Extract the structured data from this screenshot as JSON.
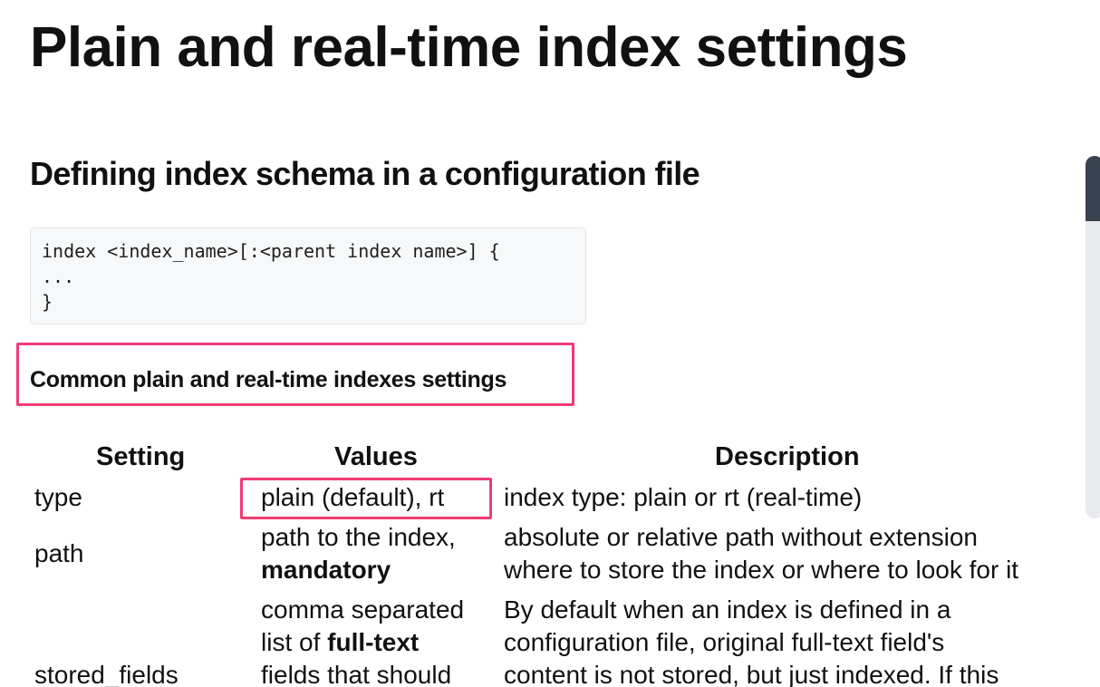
{
  "title": "Plain and real-time index settings",
  "section": {
    "heading": "Defining index schema in a configuration file",
    "code_lines": [
      "index <index_name>[:<parent index name>] {",
      "...",
      "}"
    ],
    "subheading": "Common plain and real-time indexes settings"
  },
  "table": {
    "headers": [
      "Setting",
      "Values",
      "Description"
    ],
    "rows": [
      {
        "setting": "type",
        "values": [
          "plain (default), rt"
        ],
        "description": [
          "index type: plain or rt (real-time)"
        ]
      },
      {
        "setting": "path",
        "values": [
          "path to the index,",
          "mandatory"
        ],
        "description": [
          "absolute or relative path without extension",
          "where to store the index or where to look for it"
        ]
      },
      {
        "setting": "stored_fields",
        "values": [
          "comma separated",
          "list of ",
          "full-text",
          "fields that should"
        ],
        "description": [
          "By default when an index is defined in a",
          "configuration file, original full-text field's",
          "content is not stored, but just indexed. If this"
        ]
      }
    ]
  },
  "colors": {
    "highlight": "#f03b73",
    "scrollbar_thumb": "#3a4150"
  }
}
